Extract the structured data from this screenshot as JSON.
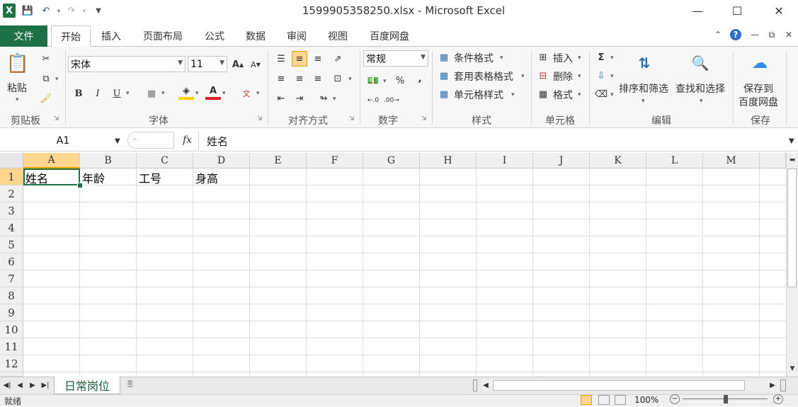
{
  "window": {
    "title": "1599905358250.xlsx - Microsoft Excel",
    "controls": {
      "minimize": "—",
      "maximize": "☐",
      "close": "✕"
    }
  },
  "ribbon_tabs": {
    "file": "文件",
    "tabs": [
      "开始",
      "插入",
      "页面布局",
      "公式",
      "数据",
      "审阅",
      "视图",
      "百度网盘"
    ]
  },
  "clipboard": {
    "paste": "粘贴",
    "group": "剪贴板"
  },
  "font": {
    "name": "宋体",
    "size": "11",
    "group": "字体",
    "bold": "B",
    "italic": "I",
    "underline": "U",
    "color_letter": "A",
    "grow": "A",
    "shrink": "A"
  },
  "alignment": {
    "group": "对齐方式"
  },
  "number": {
    "format": "常规",
    "group": "数字",
    "percent": "%",
    "comma": ","
  },
  "styles": {
    "conditional": "条件格式",
    "table": "套用表格格式",
    "cell_styles": "单元格样式",
    "group": "样式"
  },
  "cells": {
    "insert": "插入",
    "delete": "删除",
    "format": "格式",
    "group": "单元格"
  },
  "editing": {
    "sum": "Σ",
    "sort": "排序和筛选",
    "find": "查找和选择",
    "group": "编辑"
  },
  "save": {
    "line1": "保存到",
    "line2": "百度网盘",
    "group": "保存"
  },
  "formula_bar": {
    "name_box": "A1",
    "fx": "fx",
    "value": "姓名"
  },
  "grid": {
    "columns": [
      "A",
      "B",
      "C",
      "D",
      "E",
      "F",
      "G",
      "H",
      "I",
      "J",
      "K",
      "L",
      "M"
    ],
    "rows": [
      "1",
      "2",
      "3",
      "4",
      "5",
      "6",
      "7",
      "8",
      "9",
      "10",
      "11",
      "12"
    ],
    "row1": [
      "姓名",
      "年龄",
      "工号",
      "身高"
    ]
  },
  "sheets": {
    "active": "日常岗位"
  },
  "status": {
    "mode": "就绪",
    "zoom": "100%"
  },
  "colors": {
    "excel_green": "#217346",
    "file_tab": "#1e7145",
    "header_selected": "#ffd58f"
  }
}
